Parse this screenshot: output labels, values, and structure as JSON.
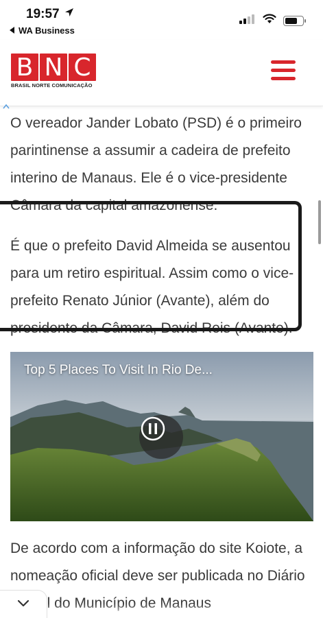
{
  "status_bar": {
    "time": "19:57",
    "back_app": "WA Business"
  },
  "header": {
    "logo_letters": [
      "B",
      "N",
      "C"
    ],
    "logo_subtitle": "BRASIL NORTE COMUNICAÇÃO",
    "brand_color": "#d8262c"
  },
  "article": {
    "paragraph_1": "O vereador Jander Lobato (PSD) é o primeiro parintinense a assumir a cadeira de prefeito interino de Manaus. Ele é o vice-presidente Câmara da capital amazonense.",
    "paragraph_2": "É que o prefeito David Almeida se ausentou para um retiro espiritual. Assim como o vice-prefeito Renato Júnior (Avante), além do presidente da Câmara, David Reis (Avante).",
    "paragraph_3": "De acordo com a informação do site Koiote, a nomeação oficial deve ser publicada no Diário Oficial do Município de Manaus"
  },
  "video": {
    "title": "Top 5 Places To Visit In Rio De...",
    "state": "playing"
  }
}
